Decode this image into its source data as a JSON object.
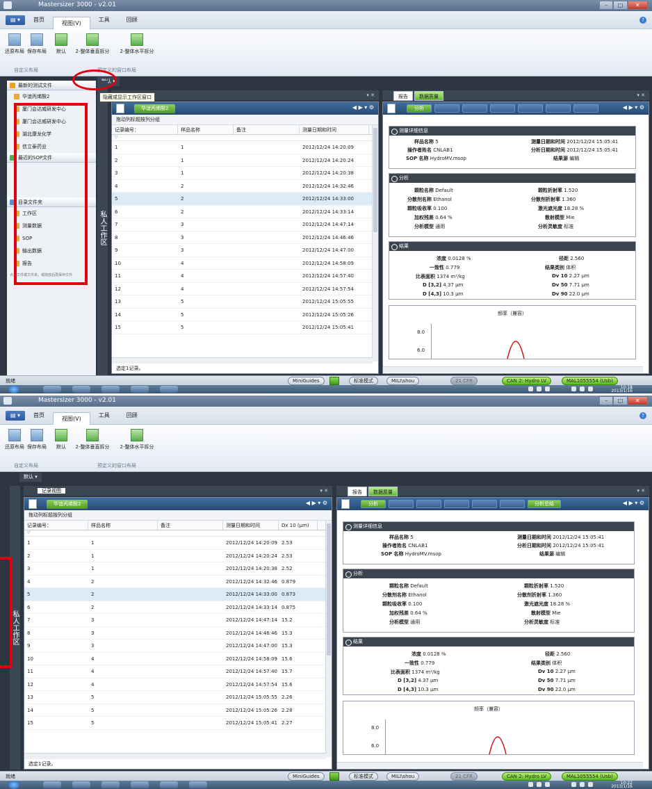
{
  "app": {
    "title": "Mastersizer 3000 - v2.01",
    "menu": [
      "首页",
      "视图(V)",
      "工具",
      "回顾"
    ],
    "ribbon": {
      "buttons": [
        "还原布局",
        "保存布局",
        "默认",
        "2-整体垂直拆分",
        "2-整体水平拆分"
      ],
      "group_custom": "自定义布局",
      "group_predefined": "预定义的窗口布局"
    },
    "layout_name": "默认",
    "tooltip": "隐藏或显示工作区窗口",
    "side_tab": "私人工作区"
  },
  "left_pane": {
    "recent_tests": "最新的测试文件",
    "test_file": "华谊丙烯酸2",
    "items": [
      "厦门会达威研发中心",
      "厦门会达威研发中心",
      "湖北康龙化学",
      "信立泰药业"
    ],
    "recent_sop": "最近的SOP文件",
    "folders_header": "目录文件夹",
    "folders": [
      "工作区",
      "测量数据",
      "SOP",
      "输出数据",
      "报告"
    ],
    "hint": "点击文件或文件夹，或拖放后再保存文件"
  },
  "records": {
    "panel_title": "记录视图",
    "tab": "华谊丙烯酸2",
    "group_hint": "拖动列标题按列分组",
    "columns": [
      "记录编号：",
      "样品名称",
      "备注",
      "测量日期和时间",
      "Dx 10 (μm)"
    ],
    "rows": [
      [
        "1",
        "1",
        "",
        "2012/12/24 14:20:09",
        "2.53"
      ],
      [
        "2",
        "1",
        "",
        "2012/12/24 14:20:24",
        "2.53"
      ],
      [
        "3",
        "1",
        "",
        "2012/12/24 14:20:38",
        "2.52"
      ],
      [
        "4",
        "2",
        "",
        "2012/12/24 14:32:46",
        "0.879"
      ],
      [
        "5",
        "2",
        "",
        "2012/12/24 14:33:00",
        "0.873"
      ],
      [
        "6",
        "2",
        "",
        "2012/12/24 14:33:14",
        "0.875"
      ],
      [
        "7",
        "3",
        "",
        "2012/12/24 14:47:14",
        "15.2"
      ],
      [
        "8",
        "3",
        "",
        "2012/12/24 14:46:46",
        "15.3"
      ],
      [
        "9",
        "3",
        "",
        "2012/12/24 14:47:00",
        "15.3"
      ],
      [
        "10",
        "4",
        "",
        "2012/12/24 14:58:09",
        "15.6"
      ],
      [
        "11",
        "4",
        "",
        "2012/12/24 14:57:40",
        "15.7"
      ],
      [
        "12",
        "4",
        "",
        "2012/12/24 14:57:54",
        "15.6"
      ],
      [
        "13",
        "5",
        "",
        "2012/12/24 15:05:55",
        "2.26"
      ],
      [
        "14",
        "5",
        "",
        "2012/12/24 15:05:26",
        "2.28"
      ],
      [
        "15",
        "5",
        "",
        "2012/12/24 15:05:41",
        "2.27"
      ]
    ],
    "selected_row": 5,
    "footer": "选定1记录。"
  },
  "report": {
    "tab_report": "报告",
    "tab_quality": "数据质量",
    "active_tab": "分析",
    "last_tab": "分析总结",
    "details": {
      "title": "测量详细信息",
      "sample_label": "样品名称",
      "sample": "5",
      "operator_label": "操作者姓名",
      "operator": "CNLAB1",
      "sop_label": "SOP 名称",
      "sop": "HydroMV.msop",
      "measured_label": "测量日期和时间",
      "measured": "2012/12/24 15:05:41",
      "analysed_label": "分析日期和时间",
      "analysed": "2012/12/24 15:05:41",
      "source_label": "结果源",
      "source": "编辑"
    },
    "analysis": {
      "title": "分析",
      "particle_label": "颗粒名称",
      "particle": "Default",
      "dispersant_label": "分散剂名称",
      "dispersant": "Ethanol",
      "absorb_label": "颗粒吸收率",
      "absorb": "0.100",
      "residual_label": "加权残差",
      "residual": "0.64 %",
      "model_label": "分析模型",
      "model": "通用",
      "pri_label": "颗粒折射率",
      "pri": "1.520",
      "dri_label": "分散剂折射率",
      "dri": "1.360",
      "obsc_label": "激光遮光度",
      "obsc": "18.28 %",
      "scatter_label": "散射模型",
      "scatter": "Mie",
      "sens_label": "分析灵敏度",
      "sens": "标准"
    },
    "result": {
      "title": "结果",
      "conc_label": "浓度",
      "conc": "0.0128 %",
      "unif_label": "一致性",
      "unif": "0.779",
      "ssa_label": "比表面积",
      "ssa": "1374 m²/kg",
      "d32_label": "D [3,2]",
      "d32": "4.37 μm",
      "d43_label": "D [4,3]",
      "d43": "10.3 μm",
      "span_label": "径距",
      "span": "2.560",
      "mode_label": "结果类别",
      "mode": "体积",
      "dv10_label": "Dv 10",
      "dv10": "2.27 μm",
      "dv50_label": "Dv 50",
      "dv50": "7.71 μm",
      "dv90_label": "Dv 90",
      "dv90": "22.0 μm"
    },
    "chart_title": "频率（兼容）",
    "y_ticks": [
      "8.0",
      "6.0"
    ]
  },
  "status": {
    "ready": "就绪",
    "minig": "MiniGuides",
    "mode": "标准模式",
    "user": "MILI\\shou",
    "cfr": "21 CFR",
    "can": "CAN 2: Hydro LV",
    "mal": "MAL1055554 (Usb)"
  },
  "taskbar": {
    "time1": "10:18",
    "date1": "2013/1/16",
    "time2": "10:22",
    "date2": "2013/1/16"
  },
  "colors": {
    "accent_green": "#5cb82a",
    "annotation_red": "#e10010",
    "panel_dark": "#2c3540"
  }
}
